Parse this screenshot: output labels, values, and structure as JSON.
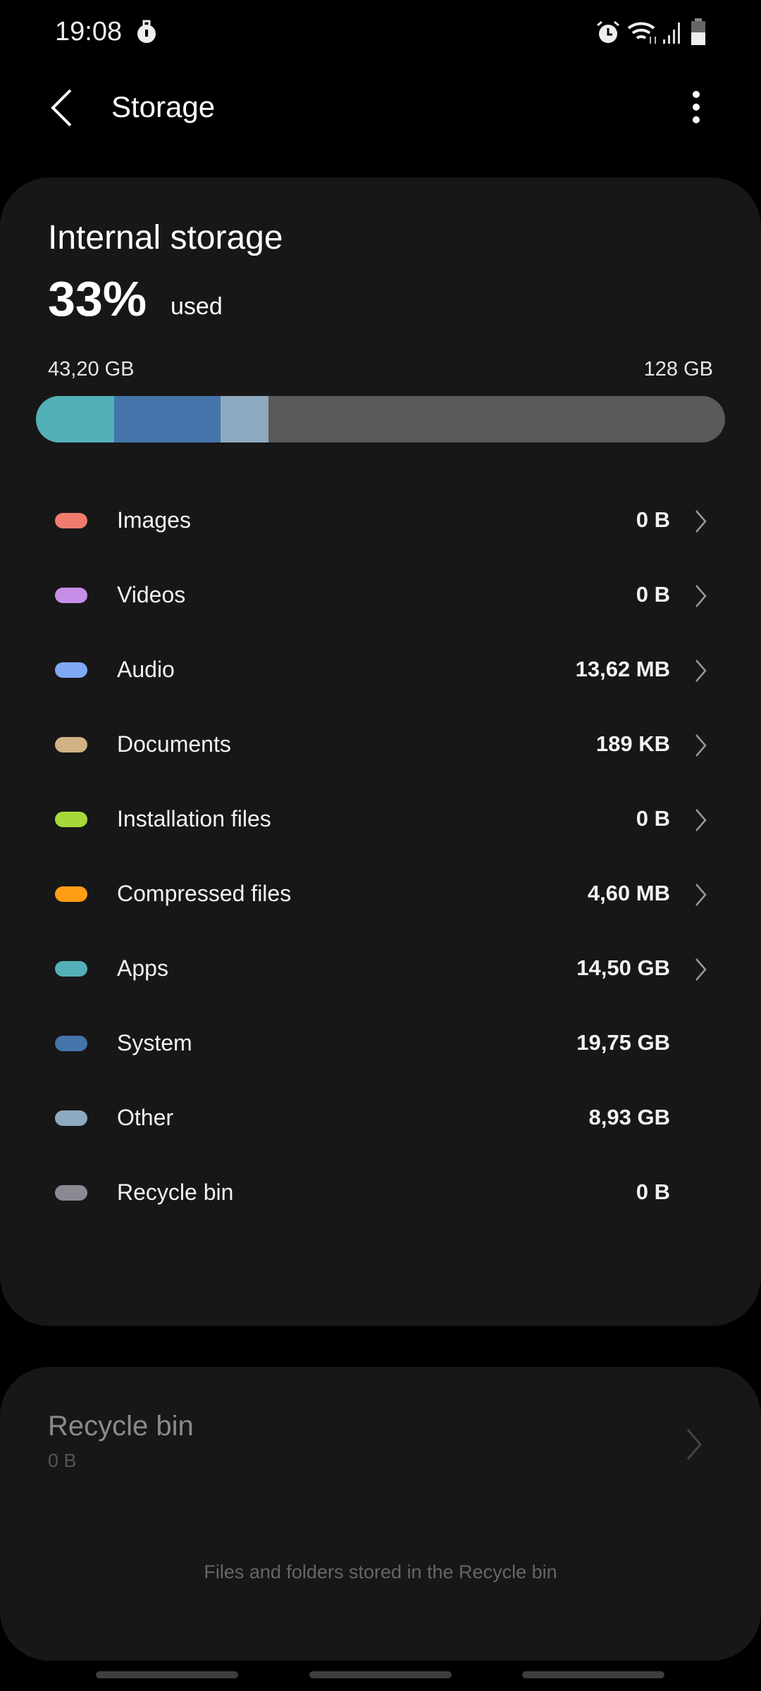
{
  "status_bar": {
    "time": "19:08",
    "icons": [
      "data-saver-icon",
      "alarm-icon",
      "wifi-icon",
      "signal-icon",
      "battery-icon"
    ]
  },
  "toolbar": {
    "title": "Storage",
    "back_icon": "chevron-left-icon",
    "more_icon": "more-vertical-icon"
  },
  "internal": {
    "title": "Internal storage",
    "percent": "33%",
    "percent_suffix": "used",
    "used": "43,20 GB",
    "total": "128 GB",
    "bar": {
      "track_color": "#5a5a5a",
      "segments": [
        {
          "category": "Apps",
          "gb": 14.5,
          "color": "#53b0b8"
        },
        {
          "category": "System",
          "gb": 19.75,
          "color": "#4574ab"
        },
        {
          "category": "Other",
          "gb": 8.93,
          "color": "#8eaac0"
        }
      ],
      "total_gb": 128
    }
  },
  "categories": [
    {
      "label": "Images",
      "value": "0 B",
      "color": "#f07b6e",
      "chevron": true
    },
    {
      "label": "Videos",
      "value": "0 B",
      "color": "#c78ee8",
      "chevron": true
    },
    {
      "label": "Audio",
      "value": "13,62 MB",
      "color": "#7fa8f5",
      "chevron": true
    },
    {
      "label": "Documents",
      "value": "189 KB",
      "color": "#d0b284",
      "chevron": true
    },
    {
      "label": "Installation files",
      "value": "0 B",
      "color": "#a6d83c",
      "chevron": true
    },
    {
      "label": "Compressed files",
      "value": "4,60 MB",
      "color": "#ff9d12",
      "chevron": true
    },
    {
      "label": "Apps",
      "value": "14,50 GB",
      "color": "#53b0b8",
      "chevron": true
    },
    {
      "label": "System",
      "value": "19,75 GB",
      "color": "#4574ab",
      "chevron": false
    },
    {
      "label": "Other",
      "value": "8,93 GB",
      "color": "#8eaac0",
      "chevron": false
    },
    {
      "label": "Recycle bin",
      "value": "0 B",
      "color": "#8a8a92",
      "chevron": false
    }
  ],
  "recycle": {
    "title": "Recycle bin",
    "size": "0 B",
    "description": "Files and folders stored in the Recycle bin"
  }
}
